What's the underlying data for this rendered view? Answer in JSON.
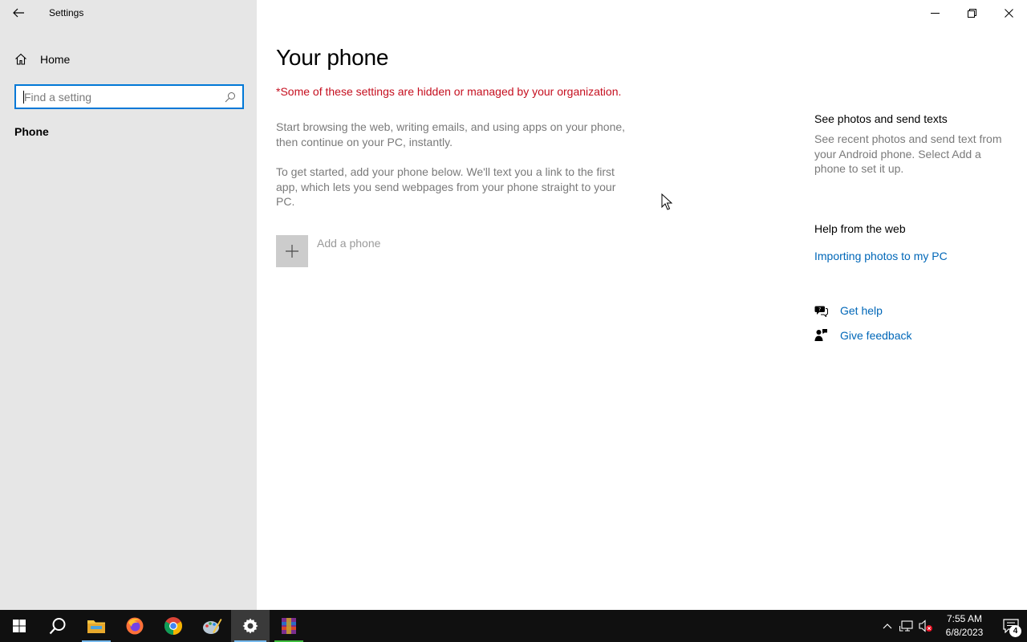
{
  "window": {
    "app_title": "Settings"
  },
  "sidebar": {
    "home_label": "Home",
    "search_placeholder": "Find a setting",
    "section_label": "Phone"
  },
  "main": {
    "title": "Your phone",
    "managed_note": "*Some of these settings are hidden or managed by your organization.",
    "paragraph1": "Start browsing the web, writing emails, and using apps on your phone, then continue on your PC, instantly.",
    "paragraph2": "To get started, add your phone below. We'll text you a link to the first app, which lets you send webpages from your phone straight to your PC.",
    "add_phone_label": "Add a phone"
  },
  "right_panel": {
    "photos_heading": "See photos and send texts",
    "photos_text": "See recent photos and send text from your Android phone. Select Add a phone to set it up.",
    "help_heading": "Help from the web",
    "help_link": "Importing photos to my PC",
    "get_help": "Get help",
    "give_feedback": "Give feedback"
  },
  "taskbar": {
    "time": "7:55 AM",
    "date": "6/8/2023",
    "notification_count": "4",
    "icons": [
      "start-icon",
      "search-icon",
      "file-explorer-icon",
      "firefox-icon",
      "chrome-icon",
      "paint-icon",
      "settings-icon",
      "winrar-icon"
    ]
  },
  "colors": {
    "accent": "#0078d7",
    "link": "#0067b8",
    "warning": "#c50f1f",
    "sidebar_bg": "#e6e6e6",
    "taskbar_bg": "#101010"
  }
}
